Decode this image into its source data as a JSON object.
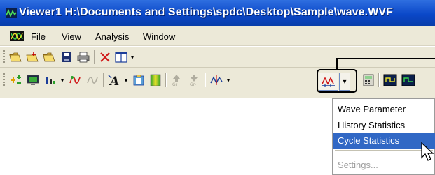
{
  "window": {
    "title": "Viewer1 H:\\Documents and Settings\\spdc\\Desktop\\Sample\\wave.WVF"
  },
  "menubar": {
    "items": [
      "File",
      "View",
      "Analysis",
      "Window"
    ]
  },
  "toolbar_statistics_dropdown": {
    "items": [
      {
        "label": "Wave Parameter",
        "state": "normal"
      },
      {
        "label": "History Statistics",
        "state": "normal"
      },
      {
        "label": "Cycle Statistics",
        "state": "highlighted"
      },
      {
        "label": "Settings...",
        "state": "disabled"
      }
    ]
  },
  "colors": {
    "titlebar": "#0a47c8",
    "chrome": "#ece9d8",
    "highlight": "#3168c5"
  }
}
